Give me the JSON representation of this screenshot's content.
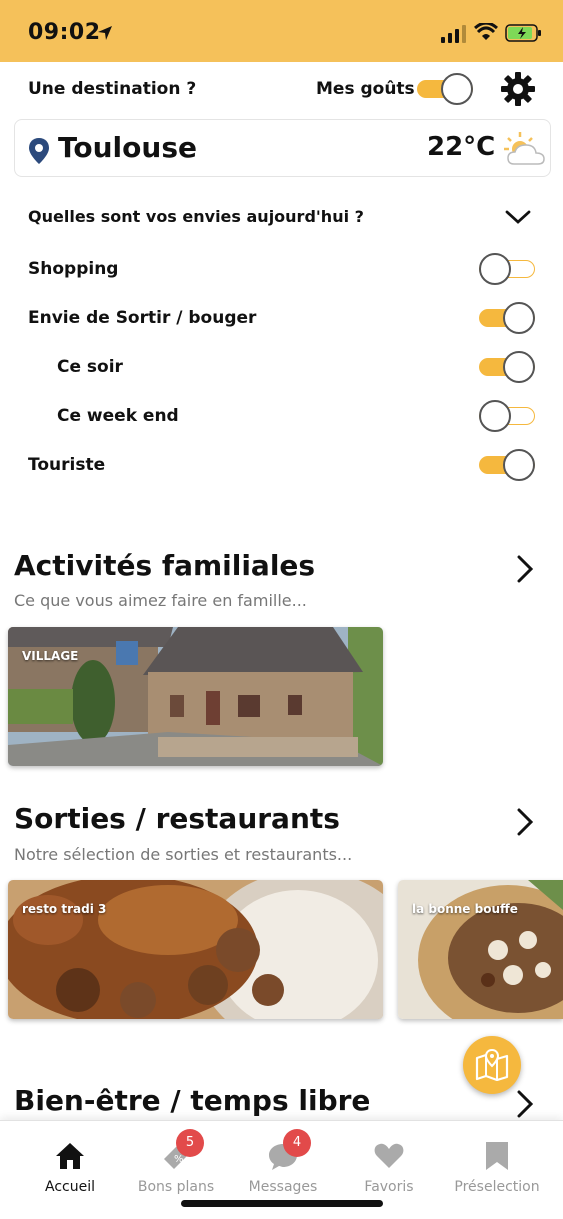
{
  "status": {
    "time": "09:02"
  },
  "header": {
    "destination_label": "Une destination ?",
    "gouts_label": "Mes goûts",
    "gouts_on": true
  },
  "location": {
    "city": "Toulouse",
    "temperature": "22°C",
    "weather_icon": "partly-cloudy-icon"
  },
  "envies": {
    "question": "Quelles sont vos envies aujourd'hui ?",
    "options": [
      {
        "label": "Shopping",
        "on": false
      },
      {
        "label": "Envie de Sortir / bouger",
        "on": true
      },
      {
        "label": "Ce soir",
        "on": true
      },
      {
        "label": "Ce week end",
        "on": false
      },
      {
        "label": "Touriste",
        "on": true
      }
    ]
  },
  "sections": [
    {
      "title": "Activités familiales",
      "subtitle": "Ce que vous aimez faire en famille...",
      "cards": [
        {
          "label": "VILLAGE"
        }
      ]
    },
    {
      "title": "Sorties / restaurants",
      "subtitle": "Notre sélection de sorties et restaurants...",
      "cards": [
        {
          "label": "resto tradi 3"
        },
        {
          "label": "la bonne bouffe"
        }
      ]
    },
    {
      "title": "Bien-être / temps libre",
      "subtitle": ""
    }
  ],
  "tabs": [
    {
      "label": "Accueil",
      "icon": "home-icon",
      "active": true
    },
    {
      "label": "Bons plans",
      "icon": "tag-icon",
      "badge": "5"
    },
    {
      "label": "Messages",
      "icon": "chat-icon",
      "badge": "4"
    },
    {
      "label": "Favoris",
      "icon": "heart-icon"
    },
    {
      "label": "Préselection",
      "icon": "bookmark-icon"
    }
  ],
  "colors": {
    "accent": "#f5b83e",
    "status_bar": "#f5c15a",
    "badge": "#e24a4a",
    "pin": "#2c4a7c"
  }
}
